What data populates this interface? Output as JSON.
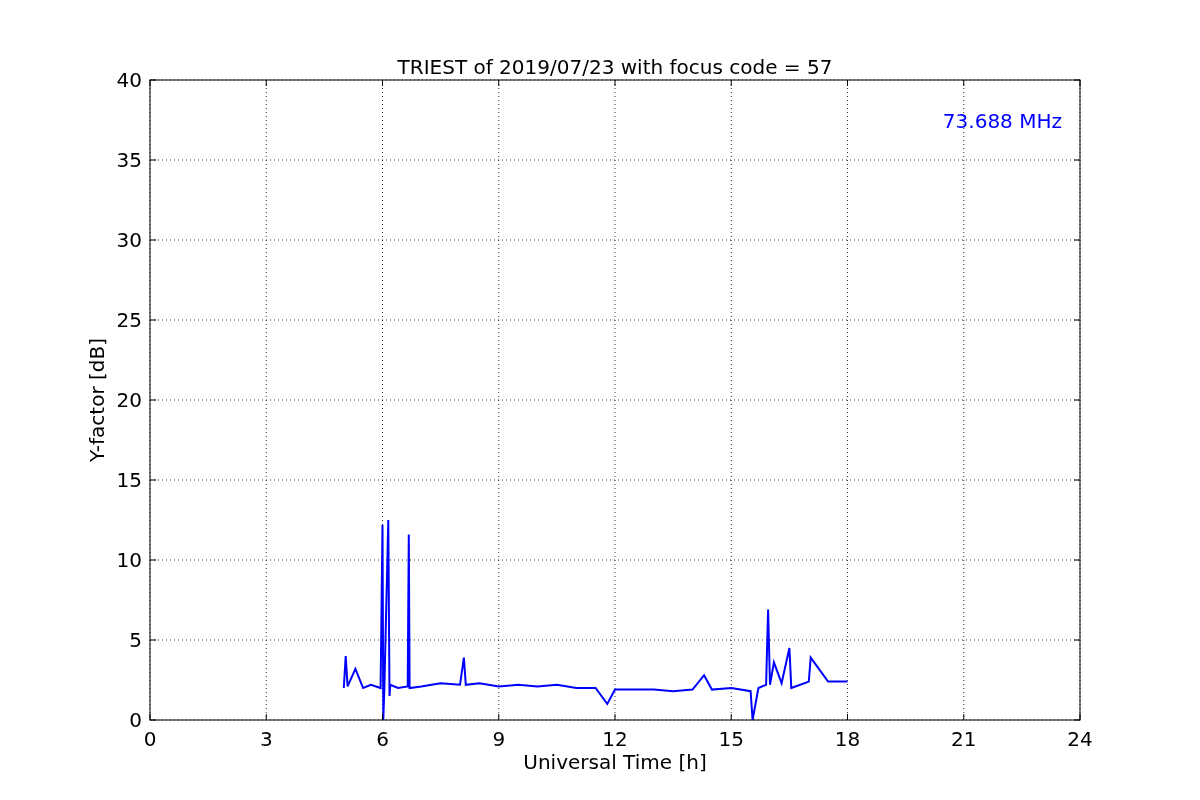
{
  "chart_data": {
    "type": "line",
    "title": "TRIEST of 2019/07/23 with focus code = 57",
    "xlabel": "Universal Time [h]",
    "ylabel": "Y-factor [dB]",
    "x": [
      5.0,
      5.05,
      5.1,
      5.3,
      5.5,
      5.7,
      5.95,
      6.0,
      6.02,
      6.05,
      6.15,
      6.18,
      6.2,
      6.4,
      6.65,
      6.68,
      6.7,
      7.0,
      7.5,
      8.0,
      8.1,
      8.15,
      8.5,
      9.0,
      9.5,
      10,
      10.5,
      11,
      11.5,
      11.8,
      12,
      12.5,
      13,
      13.5,
      14,
      14.3,
      14.5,
      15,
      15.5,
      15.55,
      15.7,
      15.9,
      15.95,
      16.0,
      16.1,
      16.3,
      16.5,
      16.55,
      17,
      17.05,
      17.5,
      18
    ],
    "series": [
      {
        "name": "73.688 MHz",
        "color": "#0000ff",
        "values": [
          2.0,
          4.0,
          2.1,
          3.2,
          2.0,
          2.2,
          2.0,
          12.2,
          0.0,
          2.1,
          12.5,
          1.5,
          2.2,
          2.0,
          2.1,
          11.6,
          2.0,
          2.1,
          2.3,
          2.2,
          3.9,
          2.2,
          2.3,
          2.1,
          2.2,
          2.1,
          2.2,
          2.0,
          2.0,
          1.0,
          1.9,
          1.9,
          1.9,
          1.8,
          1.9,
          2.8,
          1.9,
          2.0,
          1.8,
          0.0,
          2.0,
          2.2,
          6.9,
          2.2,
          3.6,
          2.3,
          4.5,
          2.0,
          2.4,
          3.9,
          2.4,
          2.4
        ]
      }
    ],
    "xlim": [
      0,
      24
    ],
    "ylim": [
      0,
      40
    ],
    "xticks": [
      0,
      3,
      6,
      9,
      12,
      15,
      18,
      21,
      24
    ],
    "yticks": [
      0,
      5,
      10,
      15,
      20,
      25,
      30,
      35,
      40
    ],
    "grid": true
  }
}
